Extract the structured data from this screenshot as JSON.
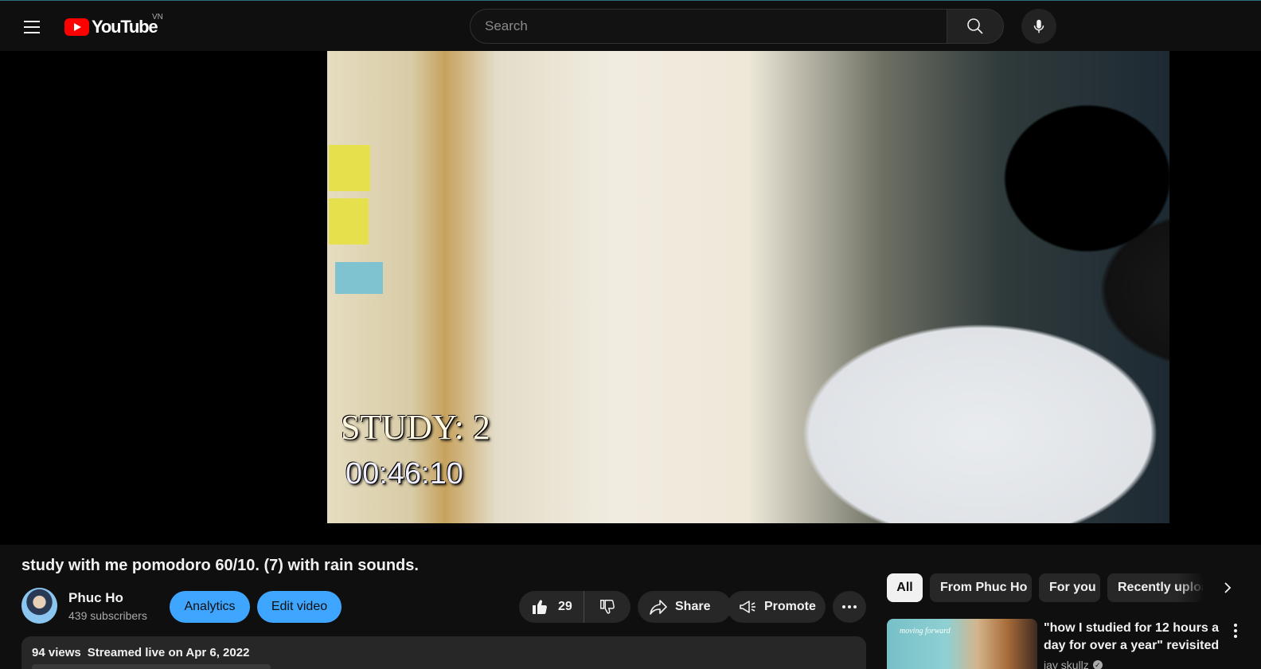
{
  "header": {
    "logo_text": "YouTube",
    "country_code": "VN",
    "search_placeholder": "Search"
  },
  "video": {
    "overlay_study": "STUDY: 2",
    "overlay_timer": "00:46:10"
  },
  "title": "study with me pomodoro 60/10. (7) with rain sounds.",
  "channel": {
    "name": "Phuc Ho",
    "subscribers": "439 subscribers"
  },
  "owner_actions": {
    "analytics": "Analytics",
    "edit_video": "Edit video"
  },
  "actions": {
    "like_count": "29",
    "share": "Share",
    "promote": "Promote"
  },
  "description": {
    "views": "94 views",
    "date": "Streamed live on Apr 6, 2022"
  },
  "chips": [
    "All",
    "From Phuc Ho",
    "For you",
    "Recently uploaded"
  ],
  "recommendation": {
    "thumb_label": "moving forward",
    "title": "\"how I studied for 12 hours a day for over a year\" revisited",
    "channel": "jay skullz"
  },
  "colors": {
    "background": "#0f0f0f",
    "accent_blue": "#3ea6ff",
    "brand_red": "#ff0000",
    "chip_bg": "#272727"
  }
}
